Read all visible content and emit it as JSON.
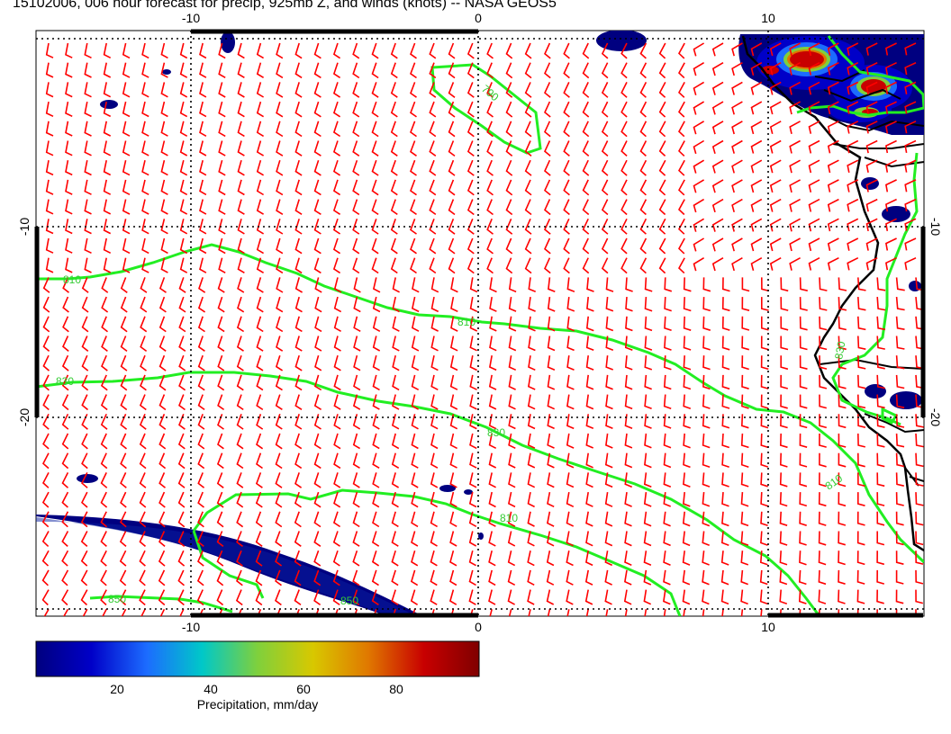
{
  "title": "15102006, 006 hour forecast for precip, 925mb Z, and winds (knots) -- NASA GEOS5",
  "map": {
    "lon_ticks": [
      "-10",
      "0",
      "10"
    ],
    "lat_ticks": [
      "-10",
      "-20"
    ],
    "colors": {
      "contour": "#22ee22",
      "contour_label": "#33cc33",
      "barb": "#ff0000",
      "coast": "#000000",
      "precip_low": "#000080"
    },
    "contour_labels": [
      "790",
      "810",
      "810",
      "830",
      "830",
      "810",
      "850",
      "850",
      "810",
      "830"
    ]
  },
  "colorbar": {
    "ticks": [
      "20",
      "40",
      "60",
      "80"
    ],
    "label": "Precipitation, mm/day",
    "colors": [
      "#00007f",
      "#0000c8",
      "#1c6cff",
      "#00c8c8",
      "#7fd03c",
      "#d8c800",
      "#e07800",
      "#c80000",
      "#800000"
    ]
  }
}
